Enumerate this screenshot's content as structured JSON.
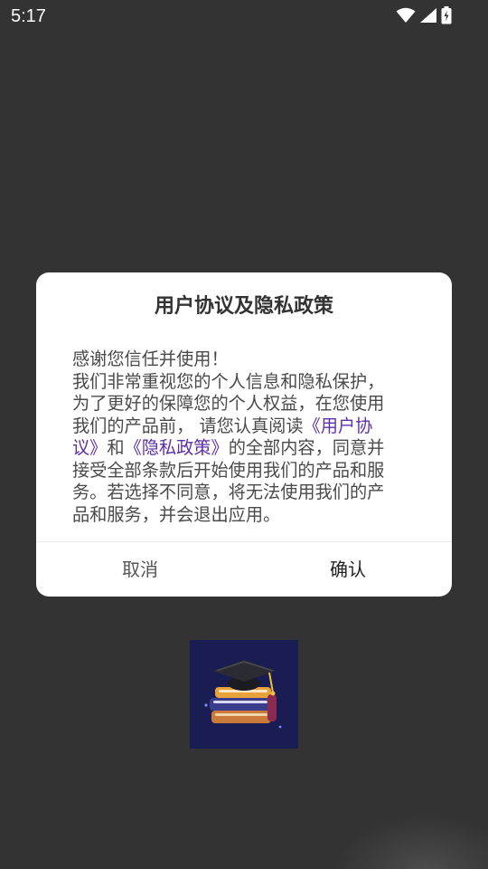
{
  "status_bar": {
    "time": "5:17",
    "icons": [
      "wifi-icon",
      "cellular-signal-icon",
      "battery-charging-icon"
    ]
  },
  "dialog": {
    "title": "用户协议及隐私政策",
    "body": {
      "line1": "感谢您信任并使用！",
      "line2": "我们非常重视您的个人信息和隐私保护，",
      "line3": "为了更好的保障您的个人权益，在您使用",
      "line4_text": "我们的产品前， 请您认真阅读",
      "user_agreement_part1": "《用户协",
      "user_agreement_part2": "议》",
      "line5_and": "和",
      "privacy_policy": "《隐私政策》",
      "line5_rest": "的全部内容，同意并",
      "line6": "接受全部条款后开始使用我们的产品和服",
      "line7": "务。若选择不同意，将无法使用我们的产",
      "line8": "品和服务，并会退出应用。"
    },
    "cancel_label": "取消",
    "confirm_label": "确认"
  },
  "colors": {
    "background": "#333333",
    "dialog": "#ffffff",
    "link": "#5d2fa8",
    "logo_background": "#1a1d52"
  },
  "splash_logo": {
    "icon": "graduation-cap-books-icon"
  }
}
